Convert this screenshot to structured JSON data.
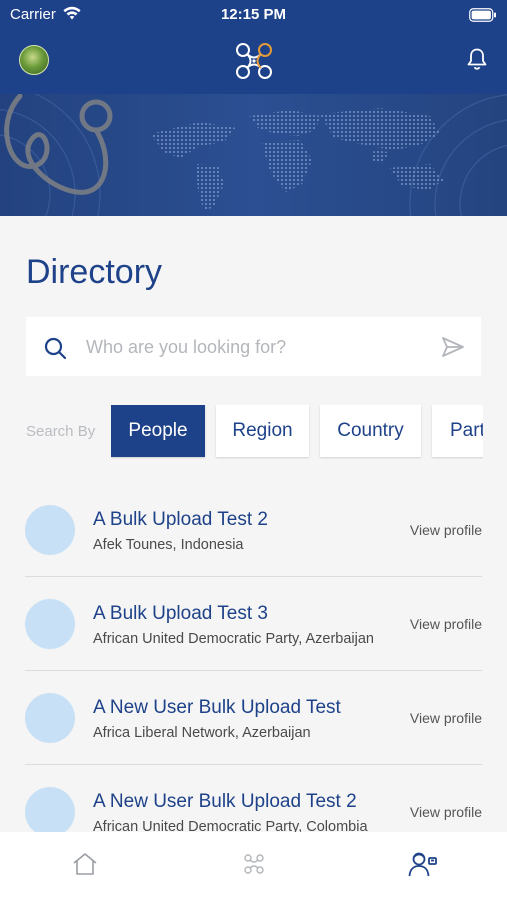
{
  "status_bar": {
    "carrier": "Carrier",
    "time": "12:15 PM",
    "icons": [
      "wifi-icon",
      "battery-icon"
    ]
  },
  "nav_bar": {
    "avatar": "user-avatar",
    "logo": "network-logo",
    "bell_icon": "bell-icon"
  },
  "page": {
    "title": "Directory"
  },
  "search": {
    "placeholder": "Who are you looking for?",
    "value": "",
    "search_icon": "search-icon",
    "submit_icon": "send-icon"
  },
  "filters": {
    "label": "Search By",
    "options": [
      "People",
      "Region",
      "Country",
      "Part"
    ],
    "selected": "People"
  },
  "results": [
    {
      "name": "A Bulk Upload Test 2",
      "subtitle": "Afek Tounes, Indonesia",
      "action": "View profile"
    },
    {
      "name": "A Bulk Upload Test 3",
      "subtitle": "African United Democratic Party, Azerbaijan",
      "action": "View profile"
    },
    {
      "name": "A New User Bulk Upload Test",
      "subtitle": "Africa Liberal Network, Azerbaijan",
      "action": "View profile"
    },
    {
      "name": "A New User Bulk Upload Test 2",
      "subtitle": "African United Democratic Party, Colombia",
      "action": "View profile"
    }
  ],
  "tab_bar": {
    "items": [
      "home-icon",
      "network-icon",
      "directory-icon"
    ],
    "active": "directory-icon"
  },
  "colors": {
    "brand_blue": "#1e4289",
    "avatar_placeholder": "#c7e0f5",
    "background": "#f5f5f5"
  }
}
